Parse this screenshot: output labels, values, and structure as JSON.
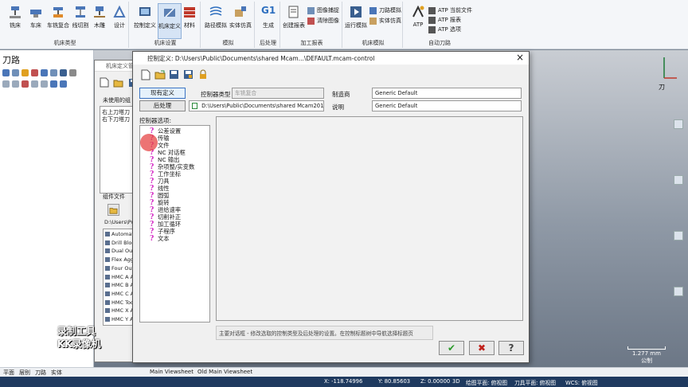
{
  "ribbon": {
    "group1": {
      "label": "机床类型",
      "buttons": [
        "铣床",
        "车床",
        "车铣复合",
        "线切割",
        "木雕",
        "设计"
      ]
    },
    "group2": {
      "label": "机床设置",
      "buttons": [
        "控制定义",
        "机床定义",
        "材料"
      ]
    },
    "group3": {
      "label": "模拟",
      "buttons": [
        "路径模拟",
        "实体仿真"
      ]
    },
    "group4": {
      "label": "后处理",
      "buttons": [
        "生成"
      ],
      "g1": "G1"
    },
    "group5": {
      "label": "加工报表",
      "buttons": [
        "创建报表"
      ],
      "small": [
        "图像捕捉",
        "清除图像"
      ]
    },
    "group6": {
      "label": "机床模拟",
      "buttons": [
        "运行模拟"
      ],
      "small": [
        "刀路模拟",
        "实体仿真"
      ]
    },
    "group7": {
      "label": "自动刀路",
      "buttons": [
        "ATP"
      ],
      "small": [
        "ATP 当前文件",
        "ATP 报表",
        "ATP 选项"
      ]
    }
  },
  "left_panel": {
    "title": "刀路"
  },
  "back_dialog": {
    "title": "机床定义管",
    "unused_label": "未使用的组",
    "list1": [
      "右上刀塔刀",
      "右下刀塔刀"
    ],
    "files_label": "组件文件",
    "path": "D:\\Users\\Pu",
    "files": [
      "Automat",
      "Drill Bloc",
      "Dual Out",
      "Flex Agg",
      "Four Out",
      "HMC A A",
      "HMC B A",
      "HMC C A",
      "HMC Too",
      "HMC X A",
      "HMC Y A"
    ]
  },
  "dialog": {
    "title": "控制定义: D:\\Users\\Public\\Documents\\shared Mcam...\\DEFAULT.mcam-control",
    "existing_btn": "现有定义",
    "post_btn": "后处理",
    "controller_type_label": "控制器类型",
    "controller_type_value": "车铣复合",
    "post_path": "D:\\Users\\Public\\Documents\\shared Mcam2017\\l",
    "manufacturer_label": "制造商",
    "manufacturer_value": "Generic Default",
    "description_label": "说明",
    "description_value": "Generic Default",
    "options_label": "控制器选项:",
    "tree_items": [
      "公差设置",
      "传输",
      "文件",
      "NC 对话框",
      "NC 输出",
      "杂项整/实变数",
      "工作坐标",
      "刀具",
      "线性",
      "圆弧",
      "旋转",
      "进给速率",
      "切削补正",
      "加工循环",
      "子程序",
      "文本"
    ],
    "status_text": "主要对话框 - 修改选取的控制类型及后处理的设置。在控制标题树中导航选择标题页",
    "ok": "✔",
    "cancel": "✖",
    "help": "?"
  },
  "watermark": {
    "line1": "录制工具",
    "line2": "KK录像机"
  },
  "axis": {
    "label": "刀"
  },
  "scale": {
    "value": "1.277 mm",
    "unit": "公制"
  },
  "bottom_tabs": [
    "平面",
    "层别",
    "刀路",
    "实体"
  ],
  "viewsheets": [
    "Main Viewsheet",
    "Old Main Viewsheet"
  ],
  "status_bar": {
    "x": "X: -118.74996",
    "y": "Y: 80.85603",
    "z": "Z: 0.00000",
    "mode": "3D",
    "cplane": "绘图平面: 俯视图",
    "tplane": "刀具平面: 俯视图",
    "wcs": "WCS: 俯视图"
  },
  "colors": {
    "accent": "#3b74c4",
    "tree_icon": "#d424c4",
    "statusbar": "#1f3a5f"
  }
}
